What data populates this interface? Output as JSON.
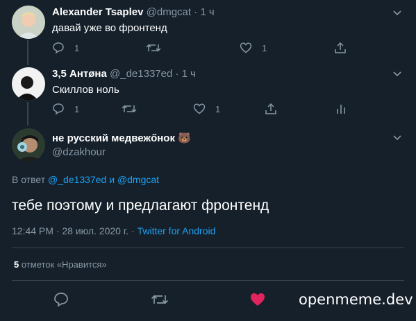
{
  "tweets": [
    {
      "name": "Alexander Tsaplev",
      "handle": "@dmgcat",
      "dot": "·",
      "time": "1 ч",
      "text": "давай уже во фронтенд",
      "reply_count": "1",
      "like_count": "1"
    },
    {
      "name": "3,5 Антøна",
      "handle": "@_de1337ed",
      "dot": "·",
      "time": "1 ч",
      "text": "Скиллов ноль",
      "reply_count": "1",
      "like_count": "1"
    }
  ],
  "main_tweet": {
    "name": "не русский медвежőнок",
    "emoji": "🐻",
    "handle": "@dzakhour",
    "reply_prefix": "В ответ",
    "reply_user1": "@_de1337ed",
    "reply_and": "и",
    "reply_user2": "@dmgcat",
    "text": "тебе поэтому и предлагают фронтенд",
    "timestamp": "12:44 PM · 28 июл. 2020 г. ·",
    "source": "Twitter for Android",
    "likes_count": "5",
    "likes_label": "отметок «Нравится»"
  },
  "watermark": "openmeme.dev",
  "colors": {
    "background": "#15202b",
    "text": "#ffffff",
    "secondary": "#8899a6",
    "accent": "#1da1f2",
    "like": "#e0245e",
    "border": "#38444d"
  }
}
